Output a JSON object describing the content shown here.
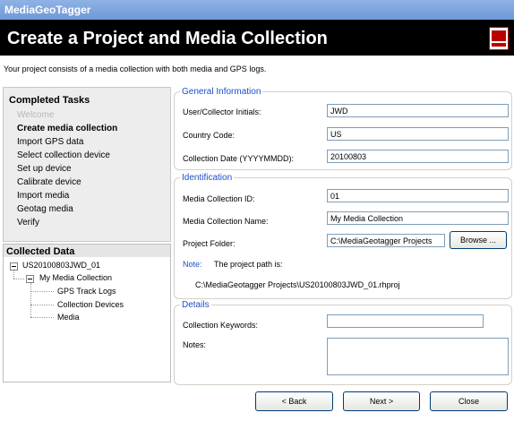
{
  "window": {
    "title": "MediaGeoTagger"
  },
  "header": {
    "title": "Create a Project and Media Collection"
  },
  "subtitle": "Your project consists of a media collection with both media and GPS logs.",
  "tasks": {
    "heading": "Completed Tasks",
    "items": [
      "Welcome",
      "Create media collection",
      "Import GPS data",
      "Select collection device",
      "Set up device",
      "Calibrate device",
      "Import media",
      "Geotag media",
      "Verify"
    ]
  },
  "collected": {
    "heading": "Collected Data",
    "root": "US20100803JWD_01",
    "child": "My Media Collection",
    "leaves": [
      "GPS Track Logs",
      "Collection Devices",
      "Media"
    ]
  },
  "general": {
    "legend": "General Information",
    "initials_label": "User/Collector Initials:",
    "initials_value": "JWD",
    "country_label": "Country Code:",
    "country_value": "US",
    "date_label": "Collection Date (YYYYMMDD):",
    "date_value": "20100803"
  },
  "identification": {
    "legend": "Identification",
    "id_label": "Media Collection ID:",
    "id_value": "01",
    "name_label": "Media Collection Name:",
    "name_value": "My Media Collection",
    "folder_label": "Project Folder:",
    "folder_value": "C:\\MediaGeotagger Projects",
    "browse_label": "Browse ...",
    "note_label": "Note:",
    "note_text": "The project path is:",
    "path": "C:\\MediaGeotagger Projects\\US20100803JWD_01.rhproj"
  },
  "details": {
    "legend": "Details",
    "keywords_label": "Collection Keywords:",
    "keywords_value": "",
    "notes_label": "Notes:",
    "notes_value": ""
  },
  "buttons": {
    "back": "< Back",
    "next": "Next >",
    "close": "Close"
  }
}
